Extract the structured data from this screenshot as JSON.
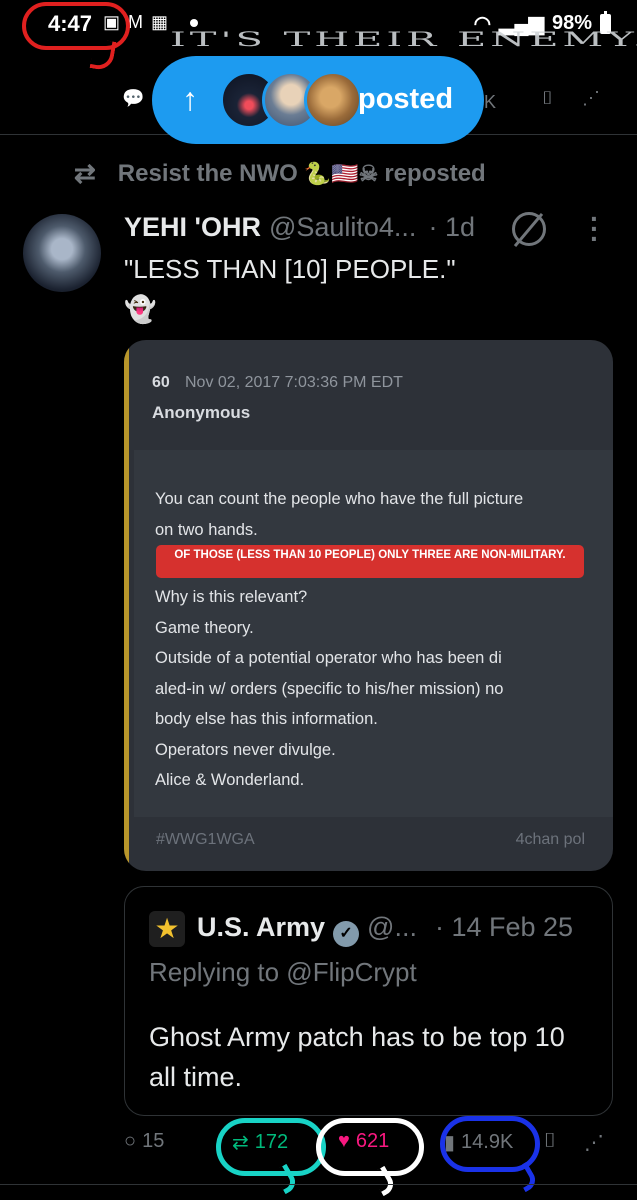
{
  "status_bar": {
    "time": "4:47",
    "left_icons": [
      "sim-icon",
      "gmail-icon",
      "calendar-icon"
    ],
    "battery": "98%"
  },
  "previous_tweet": {
    "heading_fragment": "IT'S THEIR ENEMY.",
    "views_fragment": "K"
  },
  "posted_pill": {
    "label": "posted"
  },
  "repost": {
    "name": "Resist the NWO",
    "emojis": "🐍🇺🇸☠",
    "suffix": "reposted"
  },
  "tweet": {
    "author_name": "YEHI 'OHR",
    "handle": "@Saulito4...",
    "time": "· 1d",
    "text": "\"LESS THAN [10] PEOPLE.\"",
    "emoji": "👻"
  },
  "media": {
    "post_number": "60",
    "date": "Nov 02, 2017 7:03:36 PM EDT",
    "author": "Anonymous",
    "line1": "You can count the people who have the full picture",
    "line2": "on two hands.",
    "highlight": "OF THOSE (LESS THAN 10 PEOPLE) ONLY THREE ARE NON-MILITARY.",
    "lines_after": [
      "Why is this relevant?",
      "Game theory.",
      "Outside of a potential operator who has been di",
      "aled-in w/ orders (specific to his/her mission) no",
      "body else has this information.",
      "Operators never divulge.",
      "Alice & Wonderland."
    ],
    "hashtag": "#WWG1WGA",
    "source": "4chan pol"
  },
  "quote": {
    "name": "U.S. Army",
    "handle": "@...",
    "time": "· 14 Feb 25",
    "replying": "Replying to @FlipCrypt",
    "text": "Ghost Army patch has to be top 10 all time."
  },
  "actions": {
    "replies": "15",
    "reposts": "172",
    "likes": "621",
    "views": "14.9K"
  },
  "colors": {
    "accent_blue": "#1d9bf0",
    "repost_green": "#00ba7c",
    "like_pink": "#f91880",
    "highlight_red": "#d6312e"
  }
}
